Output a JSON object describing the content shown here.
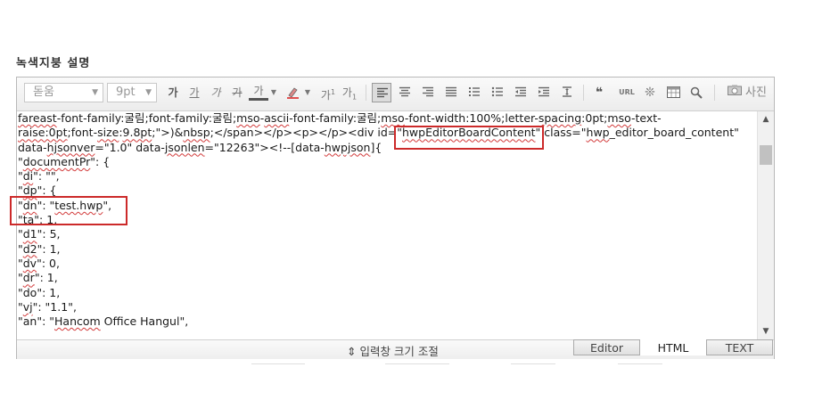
{
  "heading": "녹색지붕 설명",
  "toolbar": {
    "font_family": "돋움",
    "font_size": "9pt",
    "bold": "가",
    "underline": "가",
    "italic": "가",
    "strike": "가",
    "font_color": "가",
    "superscript": "가",
    "subscript": "가",
    "url": "URL",
    "photo": "사진"
  },
  "content_lines": [
    [
      [
        "fareast",
        "u"
      ],
      [
        "-font-family:굴림;font-family:굴림;",
        ""
      ],
      [
        "mso",
        "u"
      ],
      [
        "-",
        ""
      ],
      [
        "ascii",
        "u"
      ],
      [
        "-font-family:굴림;",
        ""
      ],
      [
        "mso",
        "u"
      ],
      [
        "-font-width:100%;letter-",
        ""
      ],
      [
        "spacing",
        "u"
      ],
      [
        ":0pt;",
        ""
      ],
      [
        "mso",
        "u"
      ],
      [
        "-text-",
        ""
      ]
    ],
    [
      [
        "raise:0pt",
        "u"
      ],
      [
        ";font-",
        ""
      ],
      [
        "size",
        "u"
      ],
      [
        ":",
        ""
      ],
      [
        "9.8pt",
        "u"
      ],
      [
        ";\">)&",
        ""
      ],
      [
        "nbsp",
        "u"
      ],
      [
        ";</span></p><p></p><div id=\"",
        ""
      ],
      [
        "hwpEditorBoardContent",
        "u"
      ],
      [
        "\" class=\"",
        ""
      ],
      [
        "hwp",
        "u"
      ],
      [
        "_editor_board_content\"",
        ""
      ]
    ],
    [
      [
        "data-",
        ""
      ],
      [
        "hjsonver",
        "u"
      ],
      [
        "=\"1.0\" data-",
        ""
      ],
      [
        "jsonlen",
        "u"
      ],
      [
        "=\"12263\"><!--[data-",
        ""
      ],
      [
        "hwpjson",
        "u"
      ],
      [
        "]{",
        ""
      ]
    ],
    [
      [
        "\"",
        ""
      ],
      [
        "documentPr",
        "u"
      ],
      [
        "\": {",
        ""
      ]
    ],
    [
      [
        "\"",
        ""
      ],
      [
        "di",
        "u"
      ],
      [
        "\": \"\",",
        ""
      ]
    ],
    [
      [
        "\"",
        ""
      ],
      [
        "dp",
        "u"
      ],
      [
        "\": {",
        ""
      ]
    ],
    [
      [
        "\"",
        ""
      ],
      [
        "dn",
        "u"
      ],
      [
        "\": \"",
        ""
      ],
      [
        "test.hwp",
        "u"
      ],
      [
        "\",",
        ""
      ]
    ],
    [
      [
        "\"ta\": 1,",
        ""
      ]
    ],
    [
      [
        "\"",
        ""
      ],
      [
        "d1",
        "u"
      ],
      [
        "\": 5,",
        ""
      ]
    ],
    [
      [
        "\"",
        ""
      ],
      [
        "d2",
        "u"
      ],
      [
        "\": 1,",
        ""
      ]
    ],
    [
      [
        "\"",
        ""
      ],
      [
        "dv",
        "u"
      ],
      [
        "\": 0,",
        ""
      ]
    ],
    [
      [
        "\"",
        ""
      ],
      [
        "dr",
        "u"
      ],
      [
        "\": 1,",
        ""
      ]
    ],
    [
      [
        "\"do\": 1,",
        ""
      ]
    ],
    [
      [
        "\"",
        ""
      ],
      [
        "vj",
        "u"
      ],
      [
        "\": \"1.1\",",
        ""
      ]
    ],
    [
      [
        "\"an\": \"",
        ""
      ],
      [
        "Hancom",
        "u"
      ],
      [
        " Office Hangul\",",
        ""
      ]
    ]
  ],
  "bottom": {
    "resize_label": "⇕ 입력창 크기 조절",
    "tabs": [
      "Editor",
      "HTML",
      "TEXT"
    ]
  }
}
